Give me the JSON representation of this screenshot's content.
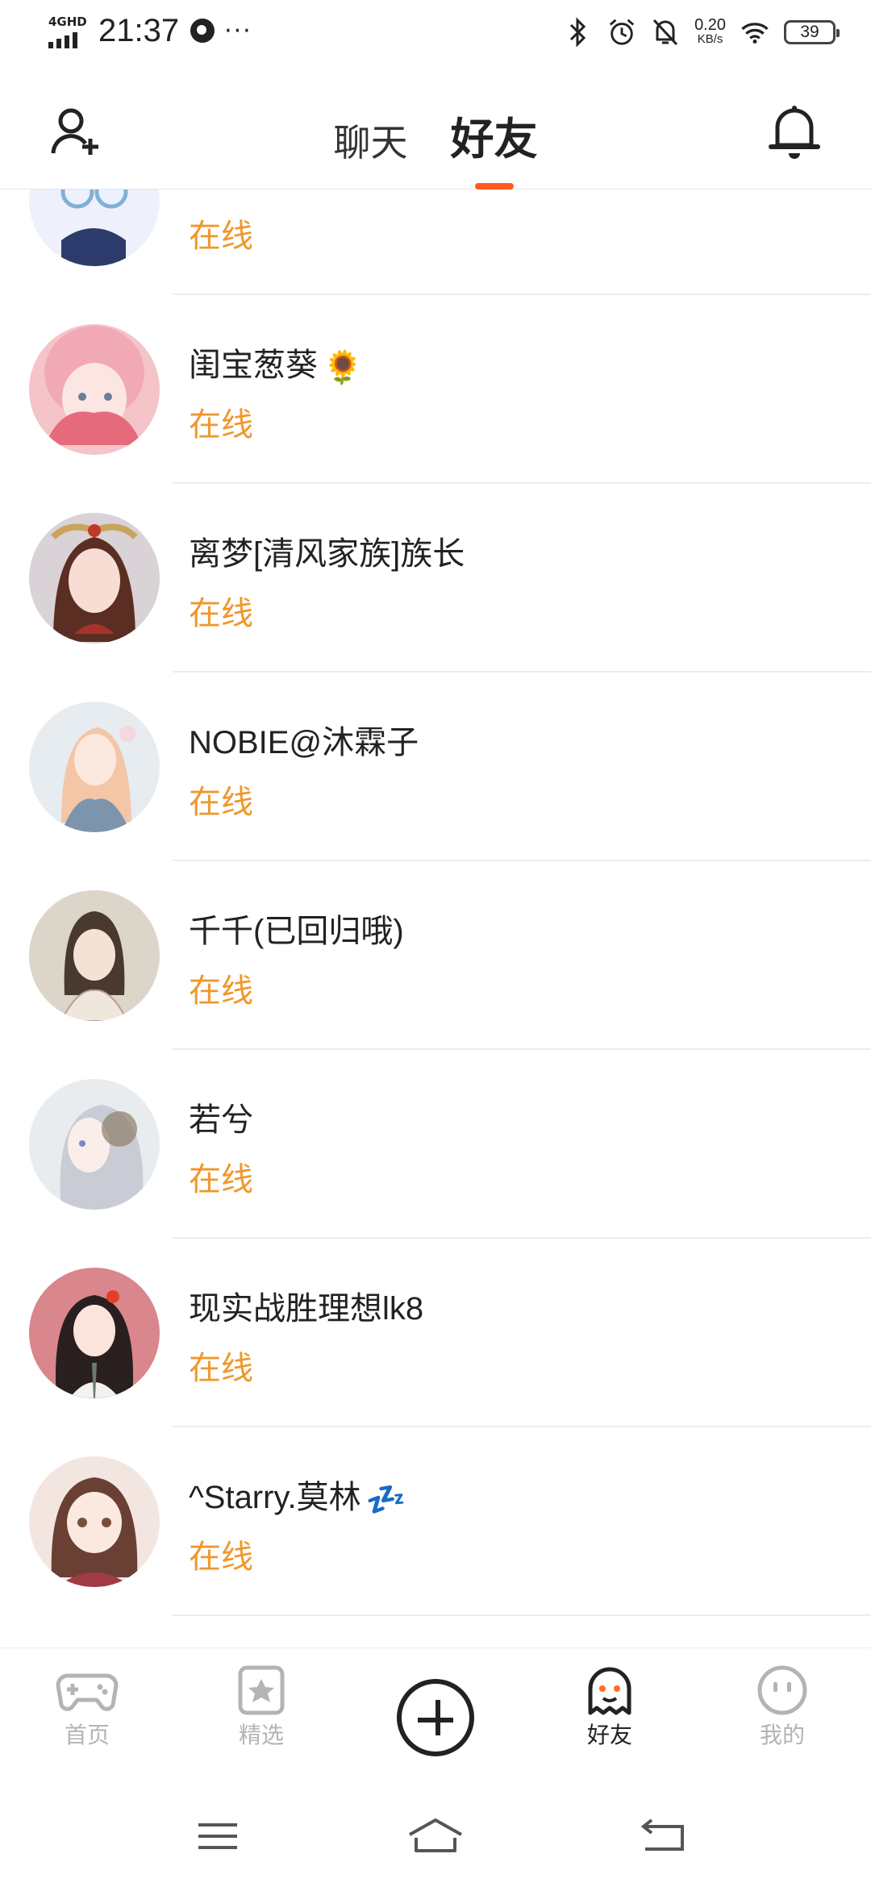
{
  "status_bar": {
    "network": "4GHD",
    "time": "21:37",
    "more": "···",
    "speed_value": "0.20",
    "speed_unit": "KB/s",
    "battery": "39"
  },
  "header": {
    "tab_chat": "聊天",
    "tab_friends": "好友",
    "active_tab": "好友"
  },
  "friends": [
    {
      "name": "",
      "status": "在线"
    },
    {
      "name": "闺宝葱葵",
      "emoji": "🌻",
      "status": "在线"
    },
    {
      "name": "离梦[清风家族]族长",
      "status": "在线"
    },
    {
      "name": "NOBIE@沐霖子",
      "status": "在线"
    },
    {
      "name": "千千(已回归哦)",
      "status": "在线"
    },
    {
      "name": "若兮",
      "status": "在线"
    },
    {
      "name": "现实战胜理想lk8",
      "status": "在线"
    },
    {
      "name": "^Starry.莫林",
      "emoji": "💤",
      "status": "在线"
    }
  ],
  "bottom_nav": {
    "home": "首页",
    "featured": "精选",
    "friends": "好友",
    "mine": "我的",
    "active": "好友"
  },
  "colors": {
    "accent": "#ff5a1f",
    "online": "#f0972b",
    "inactive_nav": "#b4b4b4"
  }
}
